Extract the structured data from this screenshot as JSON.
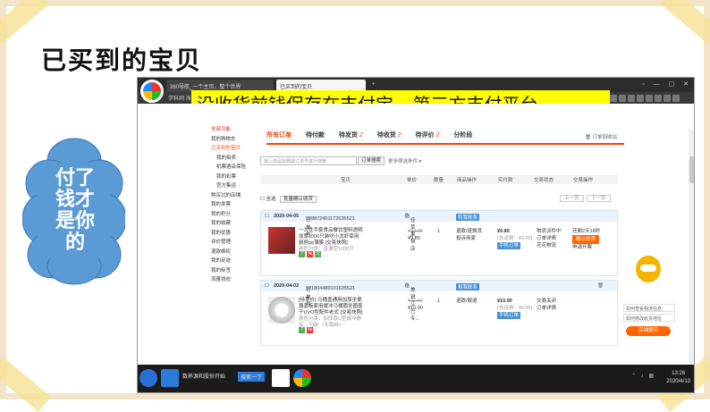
{
  "slide": {
    "title": "已买到的宝贝",
    "cloud_text": "付了钱才是你的"
  },
  "browser": {
    "tabs": [
      "360导航_一个主页，整个世界",
      "已买到的宝贝"
    ],
    "new_tab": "+",
    "address_left": "学科网 海报",
    "banner": "没收货前钱保存在支付宝---第三方支付平台"
  },
  "sidebar": {
    "header": "全部功能",
    "items": [
      "我的购物车",
      "已买到的宝贝",
      "我的拍卖",
      "机票酒店保险",
      "我的彩票",
      "官方集运",
      "购买过的店铺",
      "我的发票",
      "我的积分",
      "我的收藏",
      "我的优惠",
      "评价管理",
      "退款维权",
      "我的足迹",
      "我的标签",
      "流量钱包"
    ]
  },
  "order_tabs": [
    {
      "label": "所有订单",
      "count": ""
    },
    {
      "label": "待付款",
      "count": ""
    },
    {
      "label": "待发货",
      "count": "2"
    },
    {
      "label": "待收货",
      "count": "2"
    },
    {
      "label": "待评价",
      "count": "2"
    },
    {
      "label": "分阶段",
      "count": ""
    }
  ],
  "recycle_bin": "订单回收站",
  "search": {
    "placeholder": "输入商品标题或订单号进行搜索",
    "button": "订单搜索",
    "more": "更多筛选条件 ▾"
  },
  "columns": [
    "宝贝",
    "单价",
    "数量",
    "商品操作",
    "实付款",
    "交易状态",
    "交易操作"
  ],
  "controls": {
    "select_all": "全选",
    "batch_confirm": "批量确认收货",
    "prev": "上一页",
    "next": "下一页"
  },
  "orders": [
    {
      "date": "2020-04-05",
      "order_no_label": "订单号:",
      "order_no": "928872451172635521",
      "shop": "佳草果恒店",
      "contact": "和我联系",
      "product": "一次性手套食品餐饮塑料透明加厚1000只装吃小龙虾家用厨房pe薄膜 [交易快照]",
      "spec": "颜色分类：普通型1000只",
      "orig_price": "¥14.80",
      "price": "¥9.80",
      "qty": "1",
      "ops": [
        "退款/退换货",
        "投诉商家"
      ],
      "paid": "¥9.80",
      "paid_note": "(含运费：¥0.00)",
      "pay_type": "手机订单",
      "status": [
        "物流派件中",
        "订单详情",
        "花花物流"
      ],
      "remain": "还剩2天18时",
      "action": "确认收货",
      "action2": "申请开票"
    },
    {
      "date": "2020-04-02",
      "order_no_label": "订单号:",
      "order_no": "921804480101635521",
      "shop": "美锐艾巴专...",
      "contact": "和我联系",
      "product": "[特卖价] 马桶盖通用加厚坐便器盖板家用缓冲马桶圈坐圈盖子UVO型配件老式 [交易快照]",
      "spec": "颜色分类：加厚款U型缓冲静音 - 下缘/",
      "spec2": "（无锁丝）",
      "orig_price": "¥11.00",
      "price": "¥10.90",
      "qty": "1",
      "ops": [
        "退款/服退"
      ],
      "paid": "¥10.90",
      "paid_note": "(含运费：¥0.00)",
      "pay_type": "手机订单",
      "status": [
        "交易关闭",
        "订单详情"
      ],
      "action2": "删除"
    }
  ],
  "assistant": {
    "items": [
      "如何查看物流信息",
      "如何修改收货地址"
    ],
    "button": "店铺提问"
  },
  "taskbar": {
    "app1": "数养源和股份开始",
    "app2": "搜索一下",
    "time": "13:26",
    "date": "2020/4/13"
  },
  "colors": {
    "accent": "#ff4400",
    "banner": "#ffff00",
    "cloud": "#5b9bd5",
    "dot": "#2a7ad4"
  }
}
